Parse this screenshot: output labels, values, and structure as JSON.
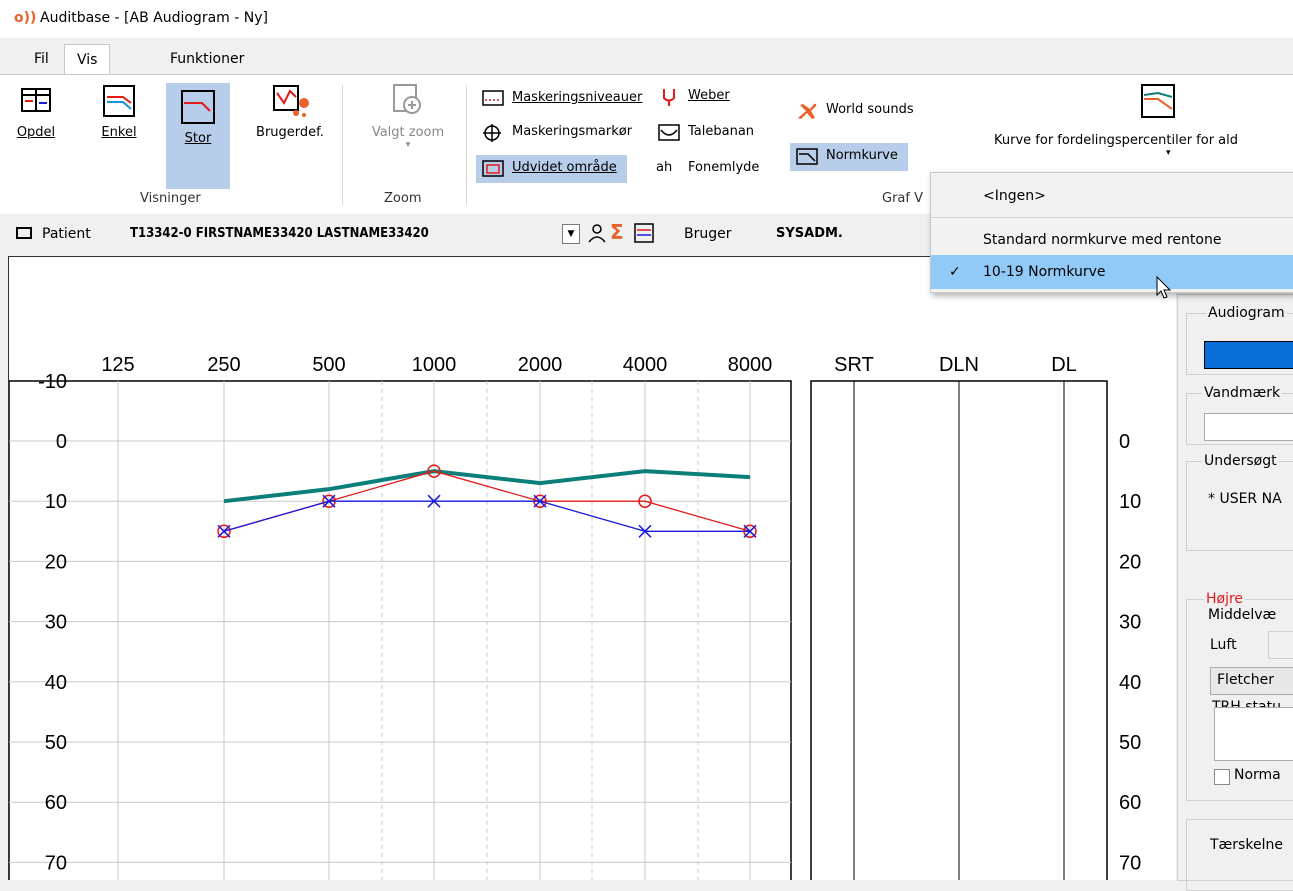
{
  "window": {
    "title": "Auditbase - [AB Audiogram - Ny]",
    "logo_text": "o))"
  },
  "menu_tabs": [
    "Fil",
    "Vis",
    "Funktioner"
  ],
  "ribbon": {
    "visninger": {
      "label": "Visninger",
      "buttons": [
        "Opdel",
        "Enkel",
        "Stor",
        "Brugerdef."
      ]
    },
    "zoom": {
      "label": "Zoom",
      "button": "Valgt zoom"
    },
    "graf": {
      "label": "Graf V",
      "items": [
        "Maskeringsniveauer",
        "Maskeringsmarkør",
        "Udvidet område",
        "Weber",
        "Talebanan",
        "Fonemlyde",
        "World sounds",
        "Normkurve"
      ],
      "fonemlyde_icon_text": "ah",
      "percentile_button": "Kurve for fordelingspercentiler for ald"
    }
  },
  "patient_bar": {
    "patient_label": "Patient",
    "patient_value": "T13342-0 FIRSTNAME33420 LASTNAME33420",
    "sigma": "Σ",
    "user_label": "Bruger",
    "user_value": "SYSADM."
  },
  "dropdown": {
    "items": [
      "<Ingen>",
      "Standard normkurve med rentone",
      "10-19 Normkurve"
    ],
    "selected_index": 2,
    "check": "✓"
  },
  "chart_data": {
    "type": "line",
    "x_labels": [
      "125",
      "250",
      "500",
      "1000",
      "2000",
      "4000",
      "8000"
    ],
    "speech_labels": [
      "SRT",
      "DLN",
      "DL"
    ],
    "y_ticks": [
      "-10",
      "0",
      "10",
      "20",
      "30",
      "40",
      "50",
      "60",
      "70"
    ],
    "y_ticks_right": [
      "0",
      "10",
      "20",
      "30",
      "40",
      "50",
      "60",
      "70"
    ],
    "ylim": [
      -10,
      72
    ],
    "series": [
      {
        "color": "#0a7f7a",
        "x": [
          250,
          500,
          1000,
          2000,
          4000,
          8000
        ],
        "values": [
          10,
          8,
          5,
          7,
          5,
          6
        ]
      },
      {
        "color": "#e21b1b",
        "marker": "circle",
        "x": [
          250,
          500,
          1000,
          2000,
          4000,
          8000
        ],
        "values": [
          15,
          10,
          5,
          10,
          10,
          15
        ]
      },
      {
        "color": "#1a1ae0",
        "marker": "x",
        "x": [
          250,
          500,
          1000,
          2000,
          4000,
          8000
        ],
        "values": [
          15,
          10,
          10,
          10,
          15,
          15
        ]
      }
    ]
  },
  "side_panel": {
    "audiogram_label": "Audiogram",
    "vandmaerke_label": "Vandmærk",
    "undersoegt_label": "Undersøgt",
    "undersoegt_value": "* USER NA",
    "hoejre_label": "Højre",
    "middelvaerdi_label": "Middelvæ",
    "luft_label": "Luft",
    "fletcher_label": "Fletcher",
    "trh_label": "TRH statu",
    "normal_label": "Norma",
    "taerskel_label": "Tærskelne"
  },
  "colors": {
    "accent_sel": "#b7cde9",
    "dropdown_sel": "#91c9f7",
    "red": "#e21b1b",
    "blue": "#1a1ae0",
    "teal": "#0a7f7a"
  }
}
